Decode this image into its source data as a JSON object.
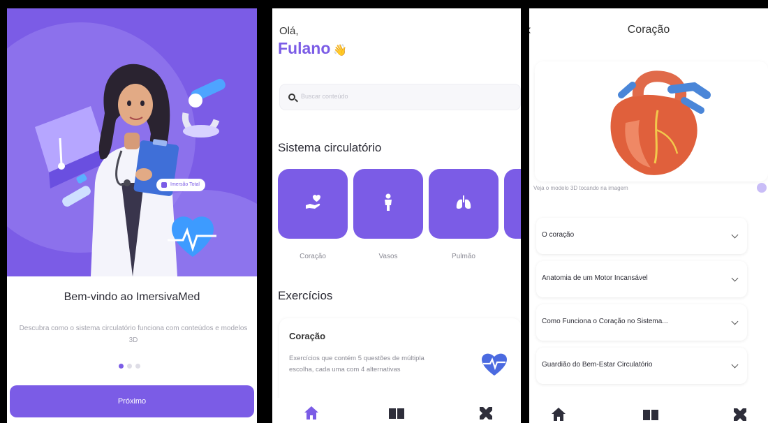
{
  "onboarding": {
    "chip_label": "Imersão Total",
    "title": "Bem-vindo ao ImersivaMed",
    "description": "Descubra como o sistema circulatório funciona com conteúdos e modelos 3D",
    "pagination": {
      "current": 1,
      "total": 3
    },
    "next_button": "Próximo"
  },
  "home": {
    "greeting": "Olá,",
    "user_name": "Fulano",
    "wave_icon": "👋",
    "search_placeholder": "Buscar conteúdo",
    "section_system": "Sistema circulatório",
    "categories": [
      {
        "label": "Coração",
        "icon": "heart-hand-icon"
      },
      {
        "label": "Vasos",
        "icon": "person-icon"
      },
      {
        "label": "Pulmão",
        "icon": "lungs-icon"
      }
    ],
    "section_exercises": "Exercícios",
    "exercise": {
      "title": "Coração",
      "description": "Exercícios que contém 5 questões de múltipla escolha, cada uma com 4 alternativas"
    },
    "nav": [
      "home-icon",
      "book-icon",
      "tools-icon"
    ]
  },
  "detail": {
    "title": "Coração",
    "hint": "Veja o modelo 3D tocando na imagem",
    "sections": [
      "O coração",
      "Anatomia de um Motor Incansável",
      "Como Funciona o Coração no Sistema...",
      "Guardião do Bem-Estar Circulatório"
    ],
    "nav": [
      "home-icon",
      "book-icon",
      "tools-icon"
    ]
  },
  "colors": {
    "accent": "#7b5ce6",
    "accent_light": "#9a84f0",
    "text_muted": "#a3a3ad"
  }
}
